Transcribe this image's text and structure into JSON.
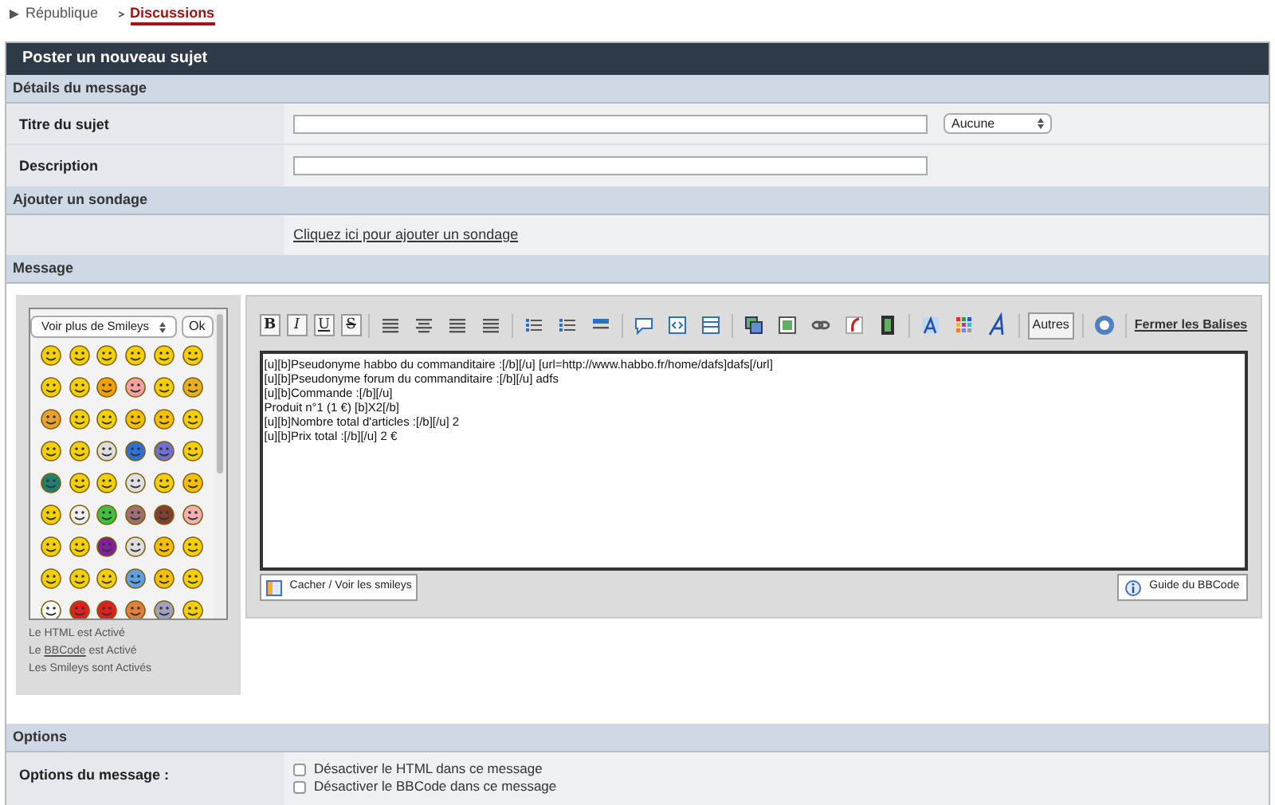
{
  "breadcrumb": [
    {
      "label": "République",
      "selected": false
    },
    {
      "label": "Discussions",
      "selected": true
    }
  ],
  "panel_title": "Poster un nouveau sujet",
  "details": {
    "heading": "Détails du message",
    "title_label": "Titre du sujet",
    "icon_select": "Aucune",
    "description_label": "Description"
  },
  "poll": {
    "heading": "Ajouter un sondage",
    "link": "Cliquez ici pour ajouter un sondage"
  },
  "message": {
    "heading": "Message",
    "smileys": {
      "select": "Voir plus de Smileys",
      "ok": "Ok",
      "status": [
        {
          "text": "Le HTML est Activé"
        },
        {
          "before": "Le ",
          "link": "BBCode",
          "after": " est Activé"
        },
        {
          "text": "Les Smileys sont Activés"
        }
      ]
    },
    "toolbar": [
      {
        "kind": "letter",
        "text": "B"
      },
      {
        "kind": "letter",
        "text": "I"
      },
      {
        "kind": "letter",
        "text": "U"
      },
      {
        "kind": "letter",
        "text": "S"
      },
      {
        "kind": "sep"
      },
      {
        "kind": "icon"
      },
      {
        "kind": "icon"
      },
      {
        "kind": "icon"
      },
      {
        "kind": "icon"
      },
      {
        "kind": "sep"
      },
      {
        "kind": "icon"
      },
      {
        "kind": "icon"
      },
      {
        "kind": "icon"
      },
      {
        "kind": "sep"
      },
      {
        "kind": "icon"
      },
      {
        "kind": "icon"
      },
      {
        "kind": "icon"
      },
      {
        "kind": "sep"
      },
      {
        "kind": "icon"
      },
      {
        "kind": "icon"
      },
      {
        "kind": "icon"
      },
      {
        "kind": "icon"
      },
      {
        "kind": "icon"
      },
      {
        "kind": "sep"
      },
      {
        "kind": "icon"
      },
      {
        "kind": "icon"
      },
      {
        "kind": "icon"
      },
      {
        "kind": "sep"
      },
      {
        "kind": "button",
        "text": "Autres"
      },
      {
        "kind": "sep"
      },
      {
        "kind": "icon"
      },
      {
        "kind": "sep"
      },
      {
        "kind": "link",
        "text": "Fermer les Balises"
      }
    ],
    "body": [
      "[u][b]Pseudonyme habbo du commanditaire :[/b][/u] [url=http://www.habbo.fr/home/dafs]dafs[/url]",
      "[u][b]Pseudonyme forum du commanditaire :[/b][/u] adfs",
      "[u][b]Commande :[/b][/u]",
      "Produit n°1 (1 €) [b]X2[/b]",
      "[u][b]Nombre total d'articles :[/b][/u] 2",
      "[u][b]Prix total :[/b][/u] 2 €"
    ],
    "toggle_smileys": "Cacher / Voir les smileys",
    "bbcode_guide": "Guide du BBCode"
  },
  "options": {
    "heading": "Options",
    "label": "Options du message :",
    "checkboxes": [
      {
        "label": "Désactiver le HTML dans ce message",
        "checked": false
      },
      {
        "label": "Désactiver le BBCode dans ce message",
        "checked": false
      }
    ]
  }
}
